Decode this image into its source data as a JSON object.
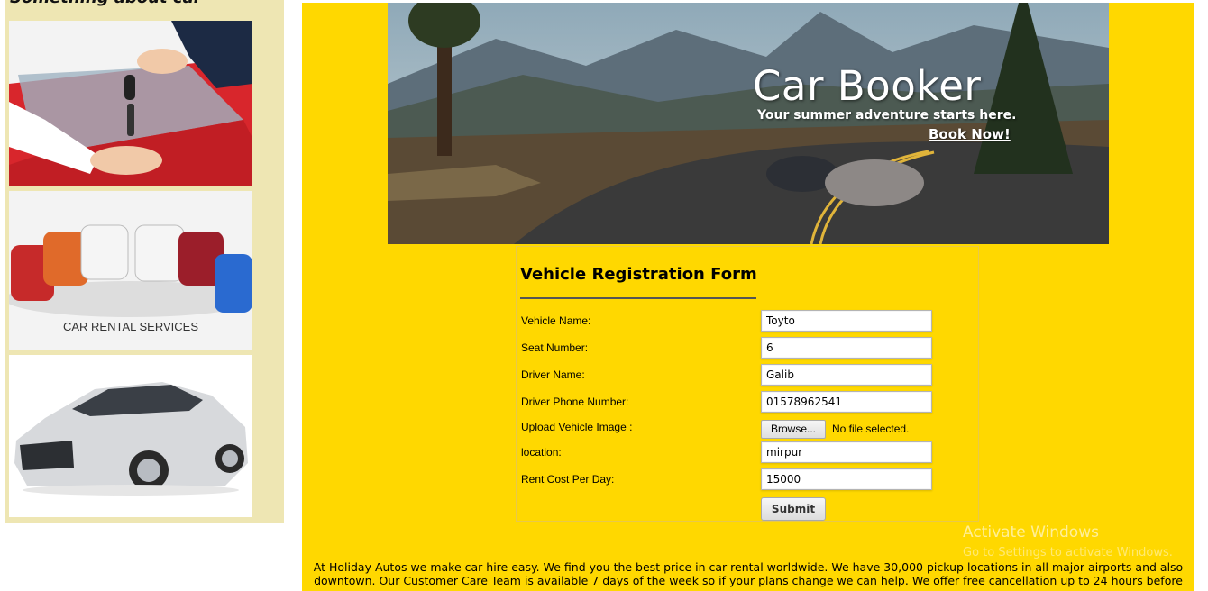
{
  "sidebar": {
    "title": "Something about car"
  },
  "banner": {
    "title": "Car Booker",
    "tagline": "Your summer adventure starts here.",
    "cta": "Book Now!"
  },
  "form": {
    "title": "Vehicle Registration Form",
    "fields": [
      {
        "label": "Vehicle Name:",
        "value": "Toyto"
      },
      {
        "label": "Seat Number:",
        "value": "6"
      },
      {
        "label": "Driver Name:",
        "value": "Galib"
      },
      {
        "label": "Driver Phone Number:",
        "value": "01578962541"
      },
      {
        "label": "Upload Vehicle Image :",
        "button": "Browse...",
        "status": "No file selected."
      },
      {
        "label": "location:",
        "value": "mirpur"
      },
      {
        "label": "Rent Cost Per Day:",
        "value": "15000"
      }
    ],
    "submit_label": "Submit"
  },
  "watermark": {
    "line1": "Activate Windows",
    "line2": "Go to Settings to activate Windows."
  },
  "footer": {
    "text": "At Holiday Autos we make car hire easy. We find you the best price in car rental worldwide. We have 30,000 pickup locations in all major airports and also downtown. Our Customer Care Team is available 7 days of the week so if your plans change we can help. We offer free cancellation up to 24 hours before"
  }
}
